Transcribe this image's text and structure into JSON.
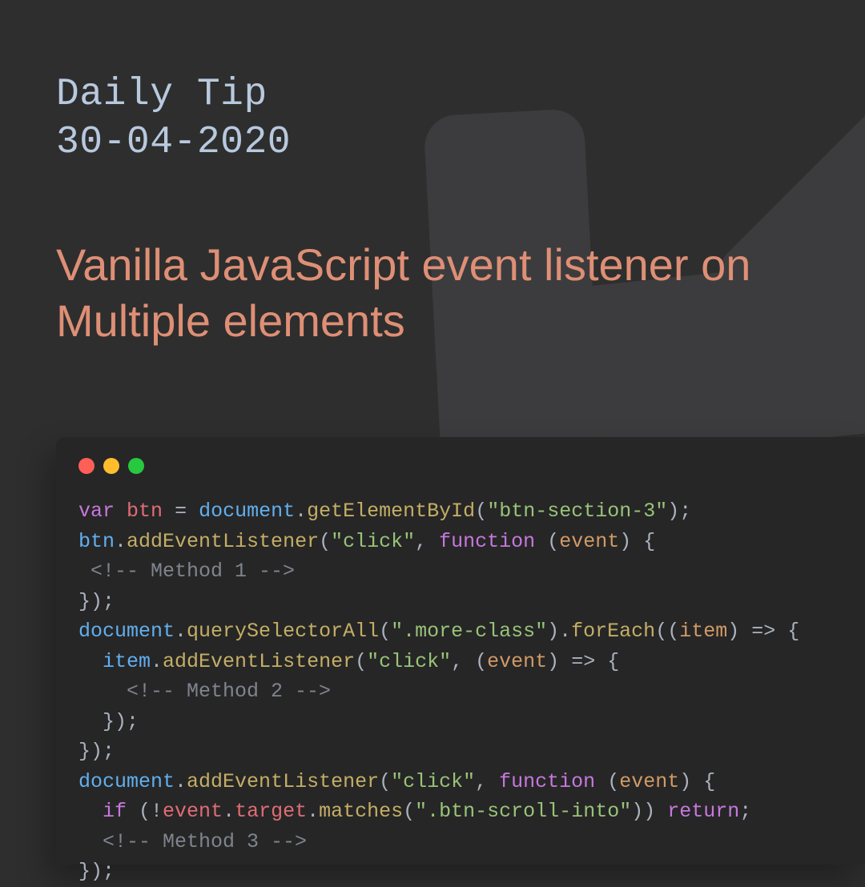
{
  "eyebrow": {
    "line1": "Daily Tip",
    "line2": "30-04-2020"
  },
  "headline": "Vanilla JavaScript event listener on Multiple elements",
  "colors": {
    "bg": "#2e2e2e",
    "card": "#262626",
    "eyebrow": "#b8c9de",
    "headline": "#de8f75",
    "traffic_red": "#ff5f56",
    "traffic_yellow": "#ffbd2e",
    "traffic_green": "#27c93f"
  },
  "code": {
    "tokens": [
      [
        [
          "kw",
          "var"
        ],
        [
          "op",
          " "
        ],
        [
          "var",
          "btn"
        ],
        [
          "op",
          " "
        ],
        [
          "op",
          "="
        ],
        [
          "op",
          " "
        ],
        [
          "obj",
          "document"
        ],
        [
          "op",
          "."
        ],
        [
          "fn",
          "getElementById"
        ],
        [
          "op",
          "("
        ],
        [
          "str",
          "\"btn-section-3\""
        ],
        [
          "op",
          ");"
        ]
      ],
      [
        [
          "obj",
          "btn"
        ],
        [
          "op",
          "."
        ],
        [
          "fn",
          "addEventListener"
        ],
        [
          "op",
          "("
        ],
        [
          "str",
          "\"click\""
        ],
        [
          "op",
          ", "
        ],
        [
          "kw",
          "function"
        ],
        [
          "op",
          " ("
        ],
        [
          "arg",
          "event"
        ],
        [
          "op",
          ") {"
        ]
      ],
      [
        [
          "op",
          " "
        ],
        [
          "cmt",
          "<!-- Method 1 -->"
        ]
      ],
      [
        [
          "op",
          "});"
        ]
      ],
      [
        [
          "obj",
          "document"
        ],
        [
          "op",
          "."
        ],
        [
          "fn",
          "querySelectorAll"
        ],
        [
          "op",
          "("
        ],
        [
          "str",
          "\".more-class\""
        ],
        [
          "op",
          ")."
        ],
        [
          "fn",
          "forEach"
        ],
        [
          "op",
          "(("
        ],
        [
          "arg",
          "item"
        ],
        [
          "op",
          ") "
        ],
        [
          "op",
          "=>"
        ],
        [
          "op",
          " {"
        ]
      ],
      [
        [
          "op",
          "  "
        ],
        [
          "obj",
          "item"
        ],
        [
          "op",
          "."
        ],
        [
          "fn",
          "addEventListener"
        ],
        [
          "op",
          "("
        ],
        [
          "str",
          "\"click\""
        ],
        [
          "op",
          ", ("
        ],
        [
          "arg",
          "event"
        ],
        [
          "op",
          ") "
        ],
        [
          "op",
          "=>"
        ],
        [
          "op",
          " {"
        ]
      ],
      [
        [
          "op",
          "    "
        ],
        [
          "cmt",
          "<!-- Method 2 -->"
        ]
      ],
      [
        [
          "op",
          "  });"
        ]
      ],
      [
        [
          "op",
          "});"
        ]
      ],
      [
        [
          "obj",
          "document"
        ],
        [
          "op",
          "."
        ],
        [
          "fn",
          "addEventListener"
        ],
        [
          "op",
          "("
        ],
        [
          "str",
          "\"click\""
        ],
        [
          "op",
          ", "
        ],
        [
          "kw",
          "function"
        ],
        [
          "op",
          " ("
        ],
        [
          "arg",
          "event"
        ],
        [
          "op",
          ") {"
        ]
      ],
      [
        [
          "op",
          "  "
        ],
        [
          "kw",
          "if"
        ],
        [
          "op",
          " (!"
        ],
        [
          "var",
          "event"
        ],
        [
          "op",
          "."
        ],
        [
          "var",
          "target"
        ],
        [
          "op",
          "."
        ],
        [
          "fn",
          "matches"
        ],
        [
          "op",
          "("
        ],
        [
          "str",
          "\".btn-scroll-into\""
        ],
        [
          "op",
          ")) "
        ],
        [
          "kw",
          "return"
        ],
        [
          "op",
          ";"
        ]
      ],
      [
        [
          "op",
          "  "
        ],
        [
          "cmt",
          "<!-- Method 3 -->"
        ]
      ],
      [
        [
          "op",
          "});"
        ]
      ]
    ]
  }
}
